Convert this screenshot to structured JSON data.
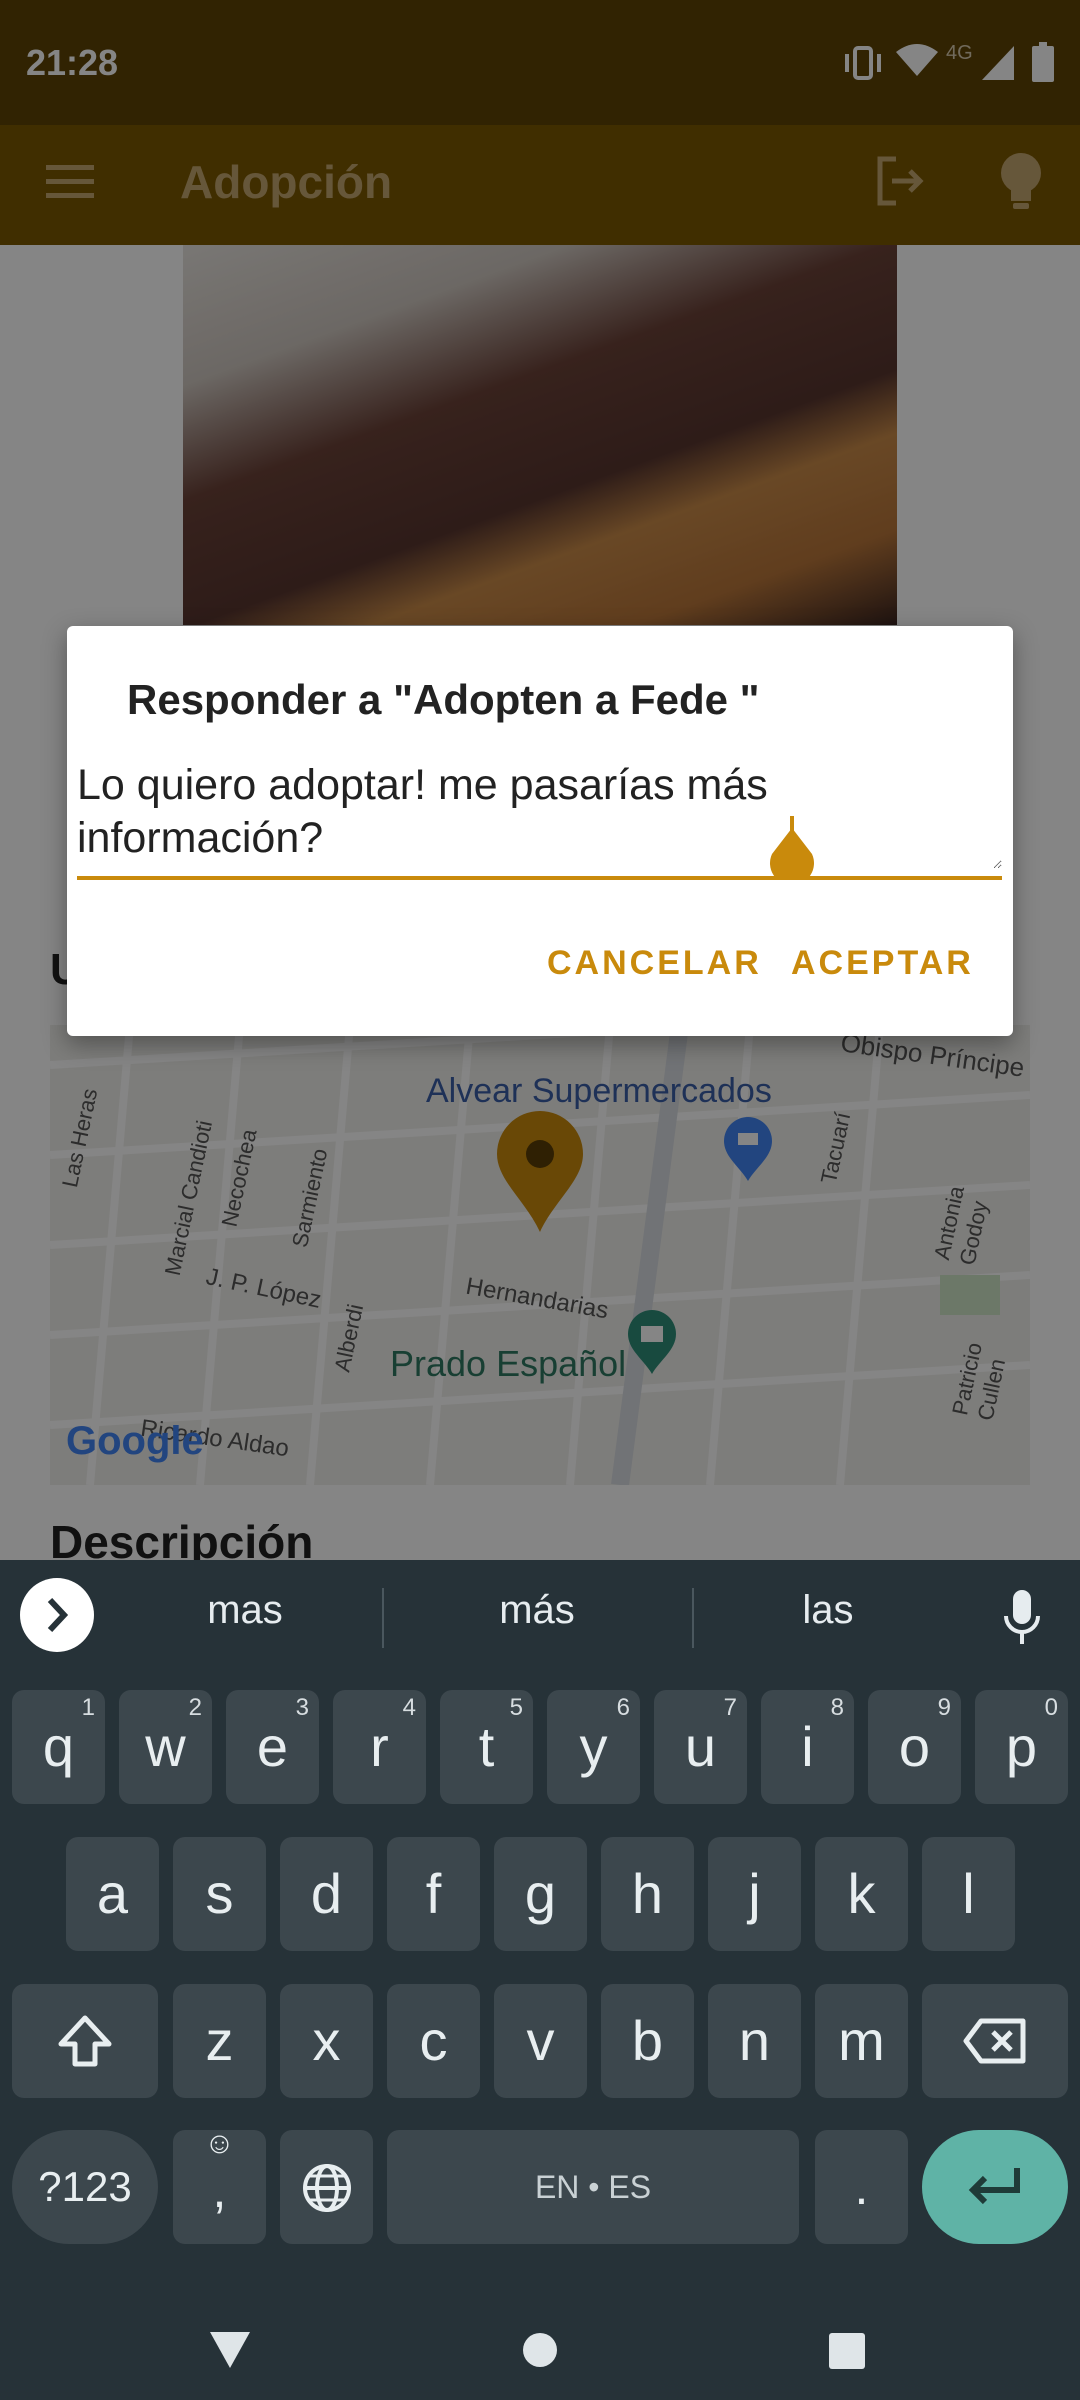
{
  "status_bar": {
    "time": "21:28",
    "network": "4G"
  },
  "app_bar": {
    "title": "Adopción"
  },
  "content": {
    "location_heading": "U",
    "description_heading": "Descripción",
    "map": {
      "places": [
        "Alvear Supermercados",
        "Prado Español",
        "Obispo Príncipe"
      ],
      "streets": [
        "Las Heras",
        "Marcial Candioti",
        "Necochea",
        "Sarmiento",
        "J. P. López",
        "Alberdi",
        "Hernandarias",
        "Tacuarí",
        "Antonia Godoy",
        "Patricio Cullen",
        "Ricardo Aldao"
      ],
      "logo": "Google"
    }
  },
  "dialog": {
    "title": "Responder a \"Adopten a Fede \"",
    "input_value": "Lo quiero adoptar! me pasarías más información?",
    "cancel_label": "CANCELAR",
    "accept_label": "ACEPTAR"
  },
  "keyboard": {
    "suggestions": [
      "mas",
      "más",
      "las"
    ],
    "row1": [
      [
        "q",
        "1"
      ],
      [
        "w",
        "2"
      ],
      [
        "e",
        "3"
      ],
      [
        "r",
        "4"
      ],
      [
        "t",
        "5"
      ],
      [
        "y",
        "6"
      ],
      [
        "u",
        "7"
      ],
      [
        "i",
        "8"
      ],
      [
        "o",
        "9"
      ],
      [
        "p",
        "0"
      ]
    ],
    "row2": [
      "a",
      "s",
      "d",
      "f",
      "g",
      "h",
      "j",
      "k",
      "l"
    ],
    "row3": [
      "z",
      "x",
      "c",
      "v",
      "b",
      "n",
      "m"
    ],
    "symbols_label": "?123",
    "comma_label": ",",
    "space_label": "EN • ES",
    "period_label": "."
  },
  "colors": {
    "accent": "#c98a0c",
    "app_bar": "#7c5900",
    "status_bar": "#5f4404",
    "keyboard_bg": "#263238",
    "enter_key": "#5fb3a6"
  }
}
